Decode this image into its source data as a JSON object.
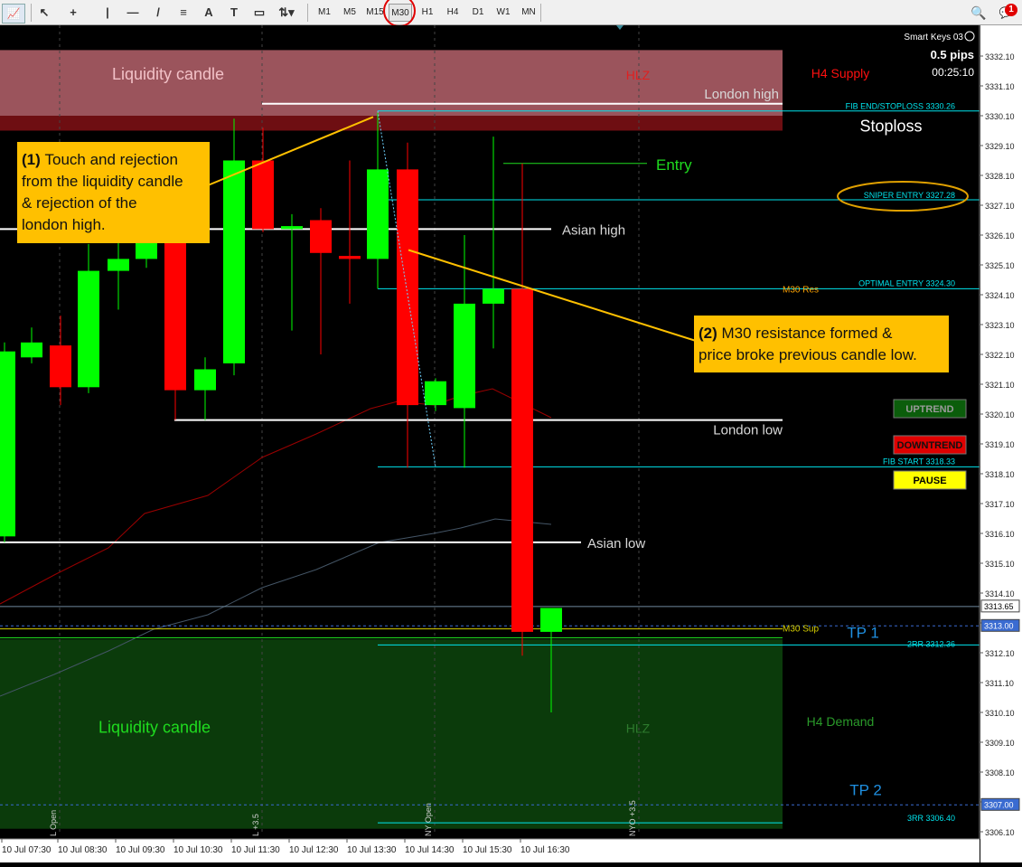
{
  "toolbar": {
    "tools": [
      {
        "name": "cursor-tool",
        "glyph": "↖"
      },
      {
        "name": "crosshair-tool",
        "glyph": "+"
      },
      {
        "name": "vertical-line-tool",
        "glyph": "|"
      },
      {
        "name": "horizontal-line-tool",
        "glyph": "—"
      },
      {
        "name": "trendline-tool",
        "glyph": "/"
      },
      {
        "name": "fibonacci-tool",
        "glyph": "≡"
      },
      {
        "name": "text-tool",
        "glyph": "A"
      },
      {
        "name": "text-label-tool",
        "glyph": "T"
      },
      {
        "name": "rectangle-tool",
        "glyph": "▭"
      },
      {
        "name": "shapes-dropdown",
        "glyph": "⇅▾"
      }
    ],
    "timeframes": [
      "M1",
      "M5",
      "M15",
      "M30",
      "H1",
      "H4",
      "D1",
      "W1",
      "MN"
    ],
    "active_timeframe": "M30",
    "notification_count": "1"
  },
  "panel": {
    "ea_name": "Smart Keys 03",
    "spread": "0.5 pips",
    "timer": "00:25:10",
    "buttons": [
      {
        "label": "UPTREND",
        "bg": "#0b5d0b",
        "fg": "#9a9a9a"
      },
      {
        "label": "DOWNTREND",
        "bg": "#e00000",
        "fg": "#111111"
      },
      {
        "label": "PAUSE",
        "bg": "#ffff00",
        "fg": "#000000"
      }
    ]
  },
  "zones": {
    "supply_label": "Liquidity candle",
    "demand_label": "Liquidity candle",
    "hlz_top": "HLZ",
    "hlz_bottom": "HLZ",
    "h4_supply": "H4 Supply",
    "h4_demand": "H4 Demand"
  },
  "levels": {
    "london_high": "London high",
    "london_low": "London low",
    "asian_high": "Asian high",
    "asian_low": "Asian low",
    "entry": "Entry",
    "stoploss": "Stoploss",
    "tp1": "TP 1",
    "tp2": "TP 2",
    "m30_res": "M30 Res",
    "m30_sup": "M30 Sup",
    "fib_end": "FIB END/STOPLOSS 3330.26",
    "sniper_entry": "SNIPER ENTRY 3327.28",
    "optimal_entry": "OPTIMAL ENTRY 3324.30",
    "fib_start": "FIB START 3318.33",
    "rr2": "2RR 3312.36",
    "rr3": "3RR 3306.40"
  },
  "annotations": {
    "note1_num": "(1)",
    "note1_lines": [
      "Touch and rejection",
      "from the liquidity candle",
      "& rejection of the",
      "london high."
    ],
    "note2_num": "(2)",
    "note2_lines": [
      "M30 resistance formed &",
      "price broke previous candle low."
    ]
  },
  "session_markers": [
    "L Open",
    "L +3.5",
    "NY Open",
    "NYO +3.5"
  ],
  "price_tags": {
    "current": "3313.65",
    "tag1": "3313.00",
    "tag2": "3307.00"
  },
  "colors": {
    "bull": "#00ff00",
    "bear": "#ff0000",
    "supply_zone": "#9b545c",
    "demand_zone": "#0b3b0b",
    "note_bg": "#ffc000",
    "cyan": "#00e5ee",
    "orange": "#ffa500"
  },
  "chart_data": {
    "type": "candlestick",
    "symbol_price_range": [
      3305.85,
      3332.3
    ],
    "price_axis_ticks": [
      "3332.10",
      "3331.10",
      "3330.10",
      "3329.10",
      "3328.10",
      "3327.10",
      "3326.10",
      "3325.10",
      "3324.10",
      "3323.10",
      "3322.10",
      "3321.10",
      "3320.10",
      "3319.10",
      "3318.10",
      "3317.10",
      "3316.10",
      "3315.10",
      "3314.10",
      "3313.10",
      "3312.10",
      "3311.10",
      "3310.10",
      "3309.10",
      "3308.10",
      "3307.10",
      "3306.10"
    ],
    "time_axis_labels": [
      "10 Jul 07:30",
      "10 Jul 08:30",
      "10 Jul 09:30",
      "10 Jul 10:30",
      "10 Jul 11:30",
      "10 Jul 12:30",
      "10 Jul 13:30",
      "10 Jul 14:30",
      "10 Jul 15:30",
      "10 Jul 16:30"
    ],
    "candles": [
      {
        "o": 3316.0,
        "h": 3322.5,
        "l": 3315.8,
        "c": 3322.2
      },
      {
        "o": 3322.0,
        "h": 3323.0,
        "l": 3321.8,
        "c": 3322.5
      },
      {
        "o": 3322.4,
        "h": 3323.4,
        "l": 3320.4,
        "c": 3321.0
      },
      {
        "o": 3321.0,
        "h": 3325.8,
        "l": 3320.8,
        "c": 3324.9
      },
      {
        "o": 3324.9,
        "h": 3326.2,
        "l": 3323.6,
        "c": 3325.3
      },
      {
        "o": 3325.3,
        "h": 3326.3,
        "l": 3325.0,
        "c": 3325.9
      },
      {
        "o": 3326.2,
        "h": 3326.8,
        "l": 3319.9,
        "c": 3320.9
      },
      {
        "o": 3320.9,
        "h": 3322.0,
        "l": 3319.9,
        "c": 3321.6
      },
      {
        "o": 3321.8,
        "h": 3330.0,
        "l": 3321.4,
        "c": 3328.6
      },
      {
        "o": 3328.6,
        "h": 3329.7,
        "l": 3326.2,
        "c": 3326.3
      },
      {
        "o": 3326.3,
        "h": 3326.8,
        "l": 3322.9,
        "c": 3326.4
      },
      {
        "o": 3326.6,
        "h": 3327.0,
        "l": 3322.1,
        "c": 3325.5
      },
      {
        "o": 3325.4,
        "h": 3328.6,
        "l": 3323.8,
        "c": 3325.3
      },
      {
        "o": 3325.3,
        "h": 3330.2,
        "l": 3324.3,
        "c": 3328.3
      },
      {
        "o": 3328.3,
        "h": 3329.2,
        "l": 3318.3,
        "c": 3320.4
      },
      {
        "o": 3320.4,
        "h": 3321.3,
        "l": 3320.2,
        "c": 3321.2
      },
      {
        "o": 3320.3,
        "h": 3326.1,
        "l": 3318.3,
        "c": 3323.8
      },
      {
        "o": 3323.8,
        "h": 3329.4,
        "l": 3322.3,
        "c": 3324.3
      },
      {
        "o": 3324.3,
        "h": 3328.5,
        "l": 3312.0,
        "c": 3312.8
      },
      {
        "o": 3312.8,
        "h": 3313.6,
        "l": 3310.1,
        "c": 3313.6
      }
    ]
  }
}
